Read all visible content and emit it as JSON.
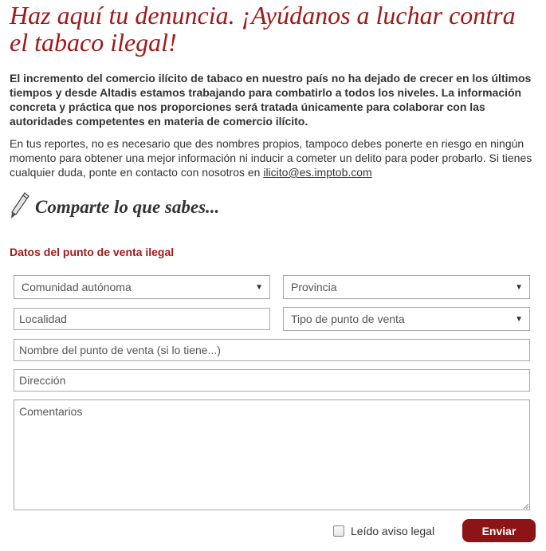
{
  "page": {
    "title": "Haz aquí tu denuncia. ¡Ayúdanos a luchar contra el tabaco ilegal!",
    "intro_bold": "El incremento del comercio ilícito de tabaco en nuestro país no ha dejado de crecer en los últimos tiempos y desde Altadis estamos trabajando para combatirlo a todos los niveles. La información concreta y práctica que nos proporciones será tratada únicamente para colaborar con las autoridades competentes en materia de comercio ilícito.",
    "intro_text": "En tus reportes, no es necesario que des nombres propios, tampoco debes ponerte en riesgo en ningún momento para obtener una mejor información ni inducir a cometer un delito para poder probarlo. Si tienes cualquier duda, ponte en contacto con nosotros en ",
    "contact_email": "ilicito@es.imptob.com",
    "share_title": "Comparte lo que sabes...",
    "share_icon": "pencil-icon"
  },
  "form": {
    "section_title": "Datos del punto de venta ilegal",
    "comunidad": {
      "value": "Comunidad autónoma"
    },
    "provincia": {
      "value": "Provincia"
    },
    "localidad": {
      "placeholder": "Localidad"
    },
    "tipo": {
      "value": "Tipo de punto de venta"
    },
    "nombre": {
      "placeholder": "Nombre del punto de venta (si lo tiene...)"
    },
    "direccion": {
      "placeholder": "Dirección"
    },
    "comentarios": {
      "placeholder": "Comentarios"
    },
    "legal_label": "Leído aviso legal",
    "legal_checked": false,
    "submit_label": "Enviar"
  },
  "colors": {
    "accent": "#a01a1a",
    "button": "#8c1414",
    "text": "#333333"
  }
}
